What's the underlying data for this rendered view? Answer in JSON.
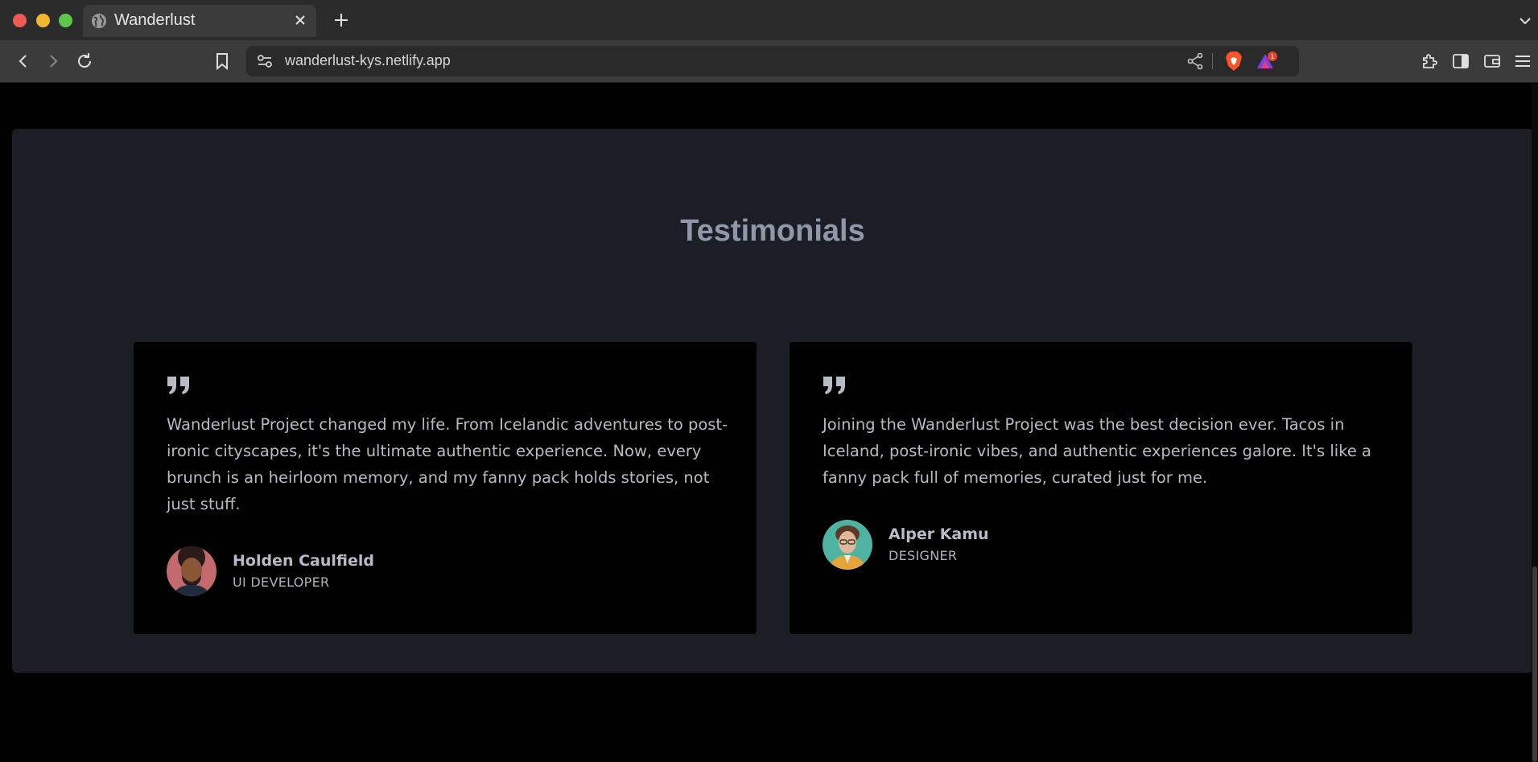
{
  "browser": {
    "tab_title": "Wanderlust",
    "url": "wanderlust-kys.netlify.app",
    "rewards_badge": "1",
    "icons": {
      "tab": "globe-icon",
      "close": "close-icon",
      "new_tab": "plus-icon",
      "back": "back-arrow-icon",
      "forward": "forward-arrow-icon",
      "reload": "reload-icon",
      "bookmark": "bookmark-icon",
      "site_info": "site-info-icon",
      "share": "share-icon",
      "shields": "brave-shields-icon",
      "rewards": "brave-rewards-icon",
      "extensions": "puzzle-icon",
      "sidebar": "sidebar-icon",
      "wallet": "wallet-icon",
      "menu": "hamburger-menu-icon"
    }
  },
  "testimonials": {
    "title": "Testimonials",
    "items": [
      {
        "quote": "Wanderlust Project changed my life. From Icelandic adventures to post-ironic cityscapes, it's the ultimate authentic experience. Now, every brunch is an heirloom memory, and my fanny pack holds stories, not just stuff.",
        "name": "Holden Caulfield",
        "role": "UI DEVELOPER"
      },
      {
        "quote": "Joining the Wanderlust Project was the best decision ever. Tacos in Iceland, post-ironic vibes, and authentic experiences galore. It's like a fanny pack full of memories, curated just for me.",
        "name": "Alper Kamu",
        "role": "DESIGNER"
      }
    ]
  },
  "colors": {
    "page_bg": "#000000",
    "section_bg": "#1b1f25",
    "card_bg": "#000000",
    "title": "#8e98a8",
    "text": "#b6bcc6"
  }
}
